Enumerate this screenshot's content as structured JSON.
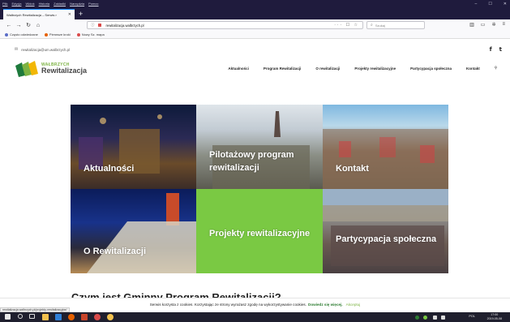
{
  "browser": {
    "menu": [
      "Plik",
      "Edycja",
      "Widok",
      "Historia",
      "Zakładki",
      "Narzędzia",
      "Pomoc"
    ],
    "window_controls": {
      "minimize": "–",
      "maximize": "☐",
      "close": "✕"
    },
    "tab": {
      "title": "Wałbrzych Rewitalizacja – Serwis r",
      "close": "✕"
    },
    "newtab": "+",
    "url": "rewitalizacja.walbrzych.pl",
    "url_actions": "··· ☐ ☆",
    "search_placeholder": "Szukaj",
    "bookmarks": [
      {
        "label": "Często odwiedzane",
        "color": "#5a6cc7"
      },
      {
        "label": "Pierwsze kroki",
        "color": "#e66000"
      },
      {
        "label": "Nowy Sz. mapa",
        "color": "#d94a4a"
      }
    ],
    "status_url": "rewitalizacja.walbrzych.pl/projekty-rewitalizacyjne/"
  },
  "site": {
    "email": "rewitalizacja@um.walbrzych.pl",
    "logo": {
      "top": "WAŁBRZYCH",
      "bottom": "Rewitalizacja",
      "colors": [
        "#1e7a3c",
        "#7cb342",
        "#f2b705"
      ]
    },
    "nav": [
      "Aktualności",
      "Program Rewitalizacji",
      "O rewitalizacji",
      "Projekty rewitalizacyjne",
      "Partycypacja społeczna",
      "Kontakt"
    ],
    "tiles": [
      {
        "label": "Aktualności"
      },
      {
        "label": "Pilotażowy program rewitalizacji"
      },
      {
        "label": "Kontakt"
      },
      {
        "label": "O Rewitalizacji"
      },
      {
        "label": "Projekty rewitalizacyjne"
      },
      {
        "label": "Partycypacja społeczna"
      }
    ],
    "peek_heading": "Czym jest Gminny Program Rewitalizacji?",
    "cookie": {
      "text": "Serwis korzysta z cookies. Korzystając ze strony wyrażasz zgodę na wykorzystywanie cookies.",
      "link": "Dowiedz się więcej.",
      "accept": "Akceptuj"
    }
  },
  "taskbar": {
    "lang": "POL",
    "time": "17:00",
    "date": "2019-05-08"
  },
  "colors": {
    "accent_green": "#7ac943",
    "dark_green": "#1e7a3c",
    "chrome_dark": "#1f1b3d"
  }
}
